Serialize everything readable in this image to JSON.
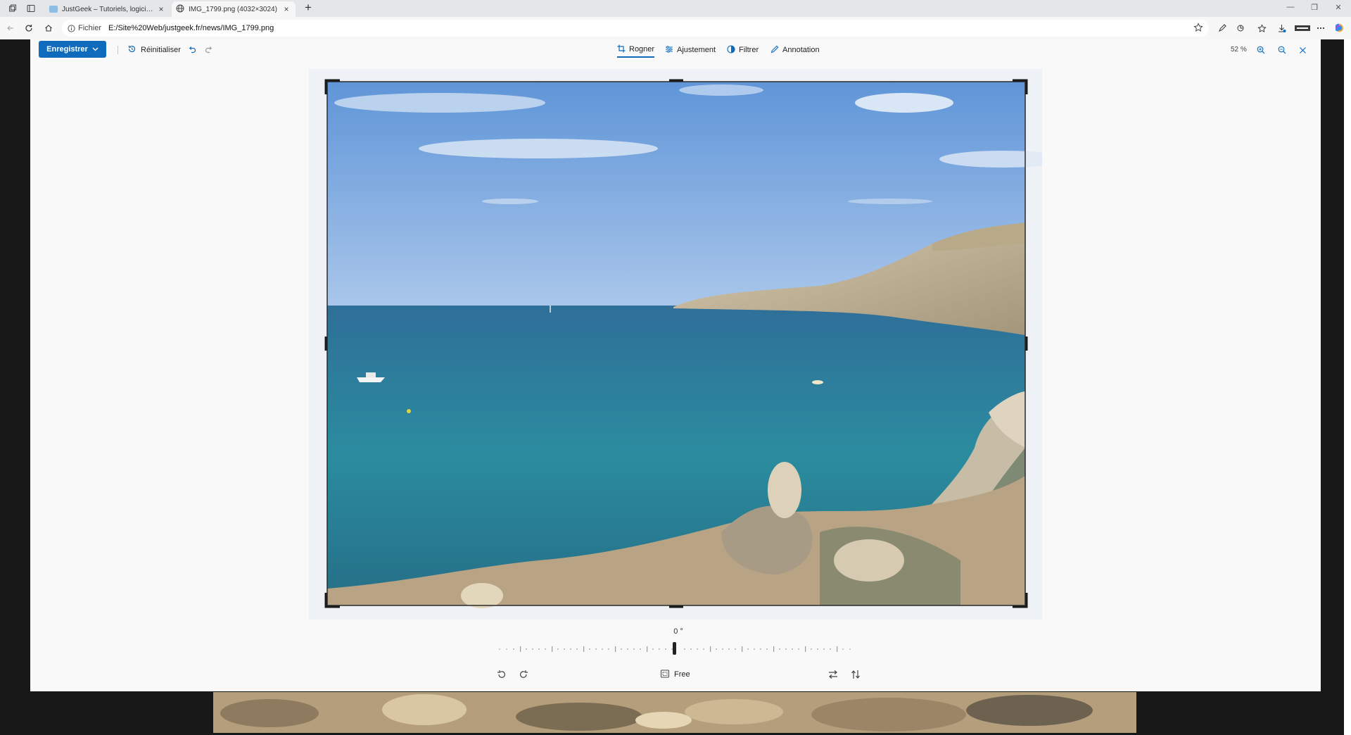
{
  "browser": {
    "tabs": [
      {
        "title": "JustGeek – Tutoriels, logiciels, astuces",
        "active": false
      },
      {
        "title": "IMG_1799.png (4032×3024)",
        "active": true
      }
    ],
    "address": {
      "site_info": "Fichier",
      "url": "E:/Site%20Web/justgeek.fr/news/IMG_1799.png"
    },
    "toolbar_icons": [
      "pen-icon",
      "refresh-icon",
      "favorites-icon",
      "downloads-icon",
      "extension-icon",
      "more-icon",
      "copilot-icon"
    ]
  },
  "editor": {
    "save_label": "Enregistrer",
    "reset_label": "Réinitialiser",
    "modes": [
      {
        "label": "Rogner",
        "icon": "crop-icon",
        "active": true
      },
      {
        "label": "Ajustement",
        "icon": "sliders-icon",
        "active": false
      },
      {
        "label": "Filtrer",
        "icon": "filter-icon",
        "active": false
      },
      {
        "label": "Annotation",
        "icon": "pen-icon",
        "active": false
      }
    ],
    "zoom_level": "52 %",
    "rotation_angle": "0 °",
    "aspect_label": "Free"
  },
  "colors": {
    "accent": "#0f6cbd",
    "backdrop": "#181818",
    "panel": "#f9f9f9"
  }
}
